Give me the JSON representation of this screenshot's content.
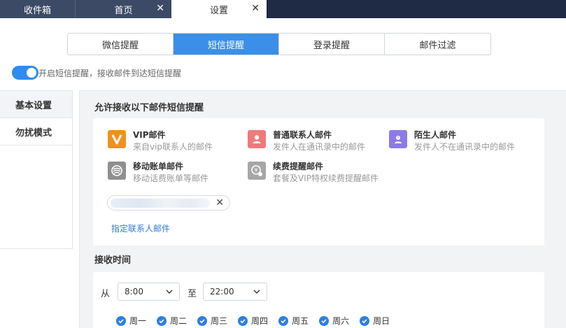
{
  "top_tabs": [
    {
      "label": "收件箱",
      "closable": false,
      "active": false
    },
    {
      "label": "首页",
      "closable": true,
      "active": false
    },
    {
      "label": "设置",
      "closable": true,
      "active": true
    }
  ],
  "segments": [
    {
      "label": "微信提醒",
      "active": false
    },
    {
      "label": "短信提醒",
      "active": true
    },
    {
      "label": "登录提醒",
      "active": false
    },
    {
      "label": "邮件过滤",
      "active": false
    }
  ],
  "sms_toggle": {
    "label": "开启短信提醒，接收邮件到达短信提醒",
    "on": true
  },
  "subnav": [
    {
      "label": "基本设置",
      "active": true
    },
    {
      "label": "勿扰模式",
      "active": false
    }
  ],
  "allow_section": {
    "title": "允许接收以下邮件短信提醒",
    "items": [
      {
        "icon": "vip-icon",
        "color": "#f0901e",
        "title": "VIP邮件",
        "desc": "来自vip联系人的邮件"
      },
      {
        "icon": "contact-icon",
        "color": "#f07a7a",
        "title": "普通联系人邮件",
        "desc": "发件人在通讯录中的邮件"
      },
      {
        "icon": "stranger-icon",
        "color": "#8c7be6",
        "title": "陌生人邮件",
        "desc": "发件人不在通讯录中的邮件"
      },
      {
        "icon": "mobile-bill-icon",
        "color": "#8f8f8f",
        "title": "移动账单邮件",
        "desc": "移动话费账单等邮件"
      },
      {
        "icon": "renewal-icon",
        "color": "#a6a6a6",
        "title": "续费提醒邮件",
        "desc": "套餐及VIP特权续费提醒邮件"
      }
    ],
    "chip_close": "✕",
    "assign_link": "指定联系人邮件"
  },
  "receive_time": {
    "title": "接收时间",
    "from_label": "从",
    "from_value": "8:00",
    "to_label": "至",
    "to_value": "22:00",
    "days": [
      "周一",
      "周二",
      "周三",
      "周四",
      "周五",
      "周六",
      "周日"
    ]
  },
  "colors": {
    "accent": "#3c8fe8",
    "toggle": "#2d8cf0",
    "link": "#2d7bd6"
  }
}
